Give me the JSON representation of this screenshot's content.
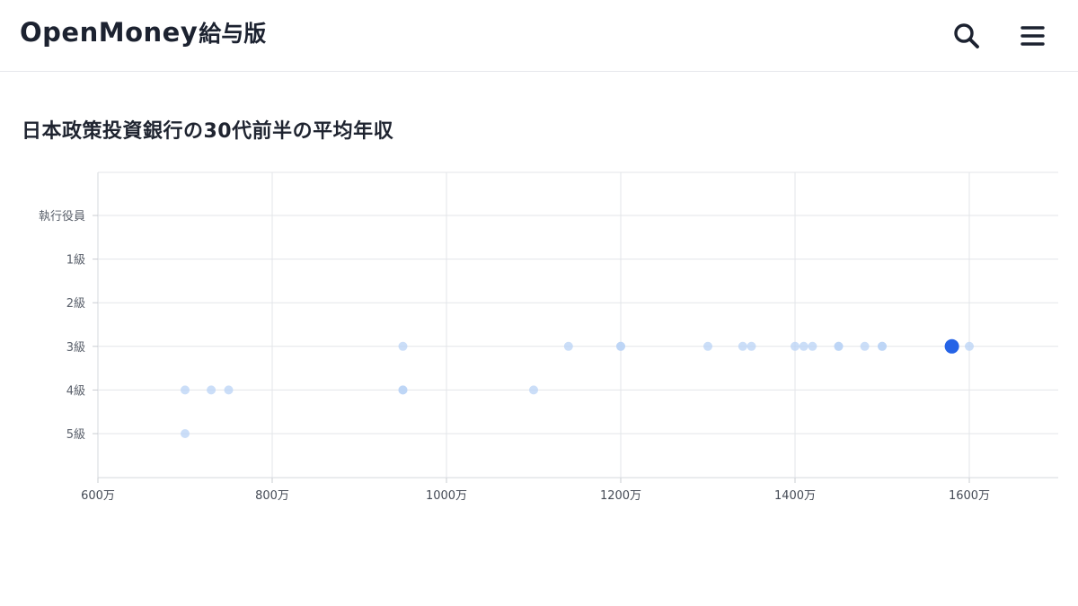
{
  "header": {
    "logo_main": "OpenMoney",
    "logo_sub": "給与版",
    "search_icon": "search-icon",
    "menu_icon": "hamburger-menu-icon"
  },
  "page": {
    "title": "日本政策投資銀行の30代前半の平均年収"
  },
  "colors": {
    "point": "#b9d3f5",
    "highlight": "#2563e6",
    "grid": "#e3e5e9",
    "text": "#1f2430"
  },
  "chart_data": {
    "type": "scatter",
    "title": "",
    "xlabel": "",
    "ylabel": "",
    "x_unit": "万",
    "xlim": [
      600,
      1700
    ],
    "x_ticks": [
      600,
      800,
      1000,
      1200,
      1400,
      1600
    ],
    "x_tick_labels": [
      "600万",
      "800万",
      "1000万",
      "1200万",
      "1400万",
      "1600万"
    ],
    "y_categories": [
      "執行役員",
      "1級",
      "2級",
      "3級",
      "4級",
      "5級"
    ],
    "grid": true,
    "points": [
      {
        "x": 700,
        "y": "5級"
      },
      {
        "x": 700,
        "y": "4級"
      },
      {
        "x": 730,
        "y": "4級"
      },
      {
        "x": 750,
        "y": "4級"
      },
      {
        "x": 950,
        "y": "4級"
      },
      {
        "x": 950,
        "y": "4級"
      },
      {
        "x": 1100,
        "y": "4級"
      },
      {
        "x": 950,
        "y": "3級"
      },
      {
        "x": 1140,
        "y": "3級"
      },
      {
        "x": 1200,
        "y": "3級"
      },
      {
        "x": 1200,
        "y": "3級"
      },
      {
        "x": 1300,
        "y": "3級"
      },
      {
        "x": 1340,
        "y": "3級"
      },
      {
        "x": 1350,
        "y": "3級"
      },
      {
        "x": 1400,
        "y": "3級"
      },
      {
        "x": 1410,
        "y": "3級"
      },
      {
        "x": 1420,
        "y": "3級"
      },
      {
        "x": 1450,
        "y": "3級"
      },
      {
        "x": 1450,
        "y": "3級"
      },
      {
        "x": 1480,
        "y": "3級"
      },
      {
        "x": 1500,
        "y": "3級"
      },
      {
        "x": 1500,
        "y": "3級"
      },
      {
        "x": 1600,
        "y": "3級"
      },
      {
        "x": 1580,
        "y": "3級",
        "highlight": true
      }
    ]
  }
}
